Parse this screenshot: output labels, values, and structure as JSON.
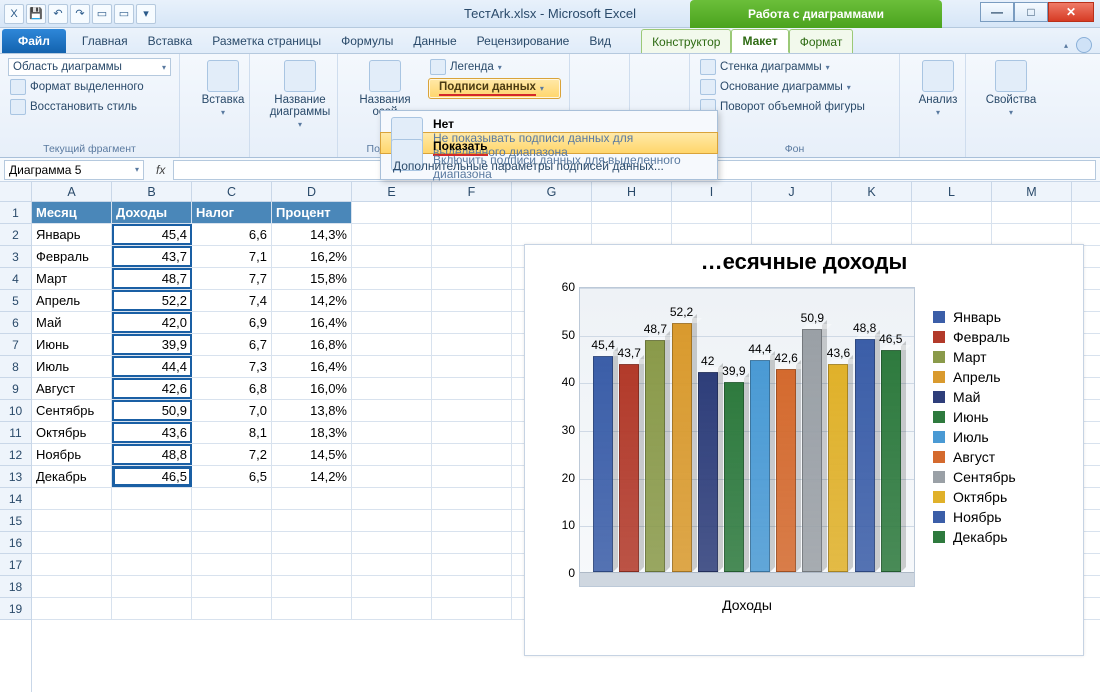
{
  "window": {
    "title": "ТестArk.xlsx - Microsoft Excel",
    "chart_tools": "Работа с диаграммами"
  },
  "tabs": {
    "file": "Файл",
    "items": [
      "Главная",
      "Вставка",
      "Разметка страницы",
      "Формулы",
      "Данные",
      "Рецензирование",
      "Вид"
    ],
    "chart_tabs": [
      "Конструктор",
      "Макет",
      "Формат"
    ],
    "active_chart_tab": 1
  },
  "ribbon": {
    "group1_label": "Текущий фрагмент",
    "chart_elements": "Область диаграммы",
    "format_selection": "Формат выделенного",
    "reset_style": "Восстановить стиль",
    "insert": "Вставка",
    "chart_title": "Название диаграммы",
    "axis_titles": "Названия осей",
    "legend": "Легенда",
    "data_labels": "Подписи данных",
    "chart_wall": "Стенка диаграммы",
    "chart_floor": "Основание диаграммы",
    "rotation_3d": "Поворот объемной фигуры",
    "group_bg": "Фон",
    "analysis": "Анализ",
    "properties": "Свойства",
    "group_sublabel_1": "Подп"
  },
  "popup": {
    "opt1_title": "Нет",
    "opt1_desc": "Не показывать подписи данных для выделенного диапазона",
    "opt2_title": "Показать",
    "opt2_desc": "Включить подписи данных для выделенного диапазона",
    "more": "Дополнительные параметры подписей данных..."
  },
  "namebox": "Диаграмма 5",
  "fx_symbol": "fx",
  "columns": [
    "A",
    "B",
    "C",
    "D",
    "E",
    "F",
    "G",
    "H",
    "I",
    "J",
    "K",
    "L",
    "M"
  ],
  "headers": [
    "Месяц",
    "Доходы",
    "Налог",
    "Процент"
  ],
  "rows": [
    {
      "m": "Январь",
      "d": "45,4",
      "n": "6,6",
      "p": "14,3%"
    },
    {
      "m": "Февраль",
      "d": "43,7",
      "n": "7,1",
      "p": "16,2%"
    },
    {
      "m": "Март",
      "d": "48,7",
      "n": "7,7",
      "p": "15,8%"
    },
    {
      "m": "Апрель",
      "d": "52,2",
      "n": "7,4",
      "p": "14,2%"
    },
    {
      "m": "Май",
      "d": "42,0",
      "n": "6,9",
      "p": "16,4%"
    },
    {
      "m": "Июнь",
      "d": "39,9",
      "n": "6,7",
      "p": "16,8%"
    },
    {
      "m": "Июль",
      "d": "44,4",
      "n": "7,3",
      "p": "16,4%"
    },
    {
      "m": "Август",
      "d": "42,6",
      "n": "6,8",
      "p": "16,0%"
    },
    {
      "m": "Сентябрь",
      "d": "50,9",
      "n": "7,0",
      "p": "13,8%"
    },
    {
      "m": "Октябрь",
      "d": "43,6",
      "n": "8,1",
      "p": "18,3%"
    },
    {
      "m": "Ноябрь",
      "d": "48,8",
      "n": "7,2",
      "p": "14,5%"
    },
    {
      "m": "Декабрь",
      "d": "46,5",
      "n": "6,5",
      "p": "14,2%"
    }
  ],
  "blank_rows": 6,
  "chart": {
    "title_visible": "…есячные доходы",
    "xlabel": "Доходы"
  },
  "chart_data": {
    "type": "bar",
    "title": "Помесячные доходы",
    "xlabel": "Доходы",
    "ylabel": "",
    "ylim": [
      0,
      60
    ],
    "yticks": [
      0,
      10,
      20,
      30,
      40,
      50,
      60
    ],
    "categories": [
      "Январь",
      "Февраль",
      "Март",
      "Апрель",
      "Май",
      "Июнь",
      "Июль",
      "Август",
      "Сентябрь",
      "Октябрь",
      "Ноябрь",
      "Декабрь"
    ],
    "values": [
      45.4,
      43.7,
      48.7,
      52.2,
      42.0,
      39.9,
      44.4,
      42.6,
      50.9,
      43.6,
      48.8,
      46.5
    ],
    "colors": [
      "#3b5ea8",
      "#b23a2a",
      "#8a9a4a",
      "#d99a2e",
      "#2e3e7a",
      "#2e7a3e",
      "#4a9ad4",
      "#d46a2e",
      "#9aa0a6",
      "#e0b12a",
      "#3b5ea8",
      "#2e7a3e"
    ]
  }
}
